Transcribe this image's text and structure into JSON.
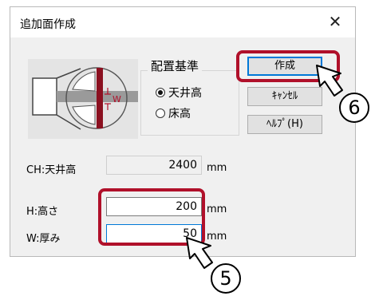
{
  "dialog": {
    "title": "追加面作成",
    "close_glyph": "✕"
  },
  "placement": {
    "group_label": "配置基準",
    "options": [
      {
        "label": "天井高",
        "selected": true
      },
      {
        "label": "床高",
        "selected": false
      }
    ]
  },
  "preview": {
    "dimension_label": "W"
  },
  "buttons": {
    "create": "作成",
    "cancel": "ｷｬﾝｾﾙ",
    "help": "ﾍﾙﾌﾟ(H)"
  },
  "fields": {
    "ceiling_height": {
      "label": "CH:天井高",
      "value": "2400",
      "unit": "mm"
    },
    "height": {
      "label": "H:高さ",
      "value": "200",
      "unit": "mm"
    },
    "thickness": {
      "label": "W:厚み",
      "value": "50",
      "unit": "mm"
    }
  },
  "annotations": {
    "step_create": "6",
    "step_fields": "5"
  },
  "colors": {
    "highlight": "#b0102a",
    "focus_border": "#0078d7"
  }
}
